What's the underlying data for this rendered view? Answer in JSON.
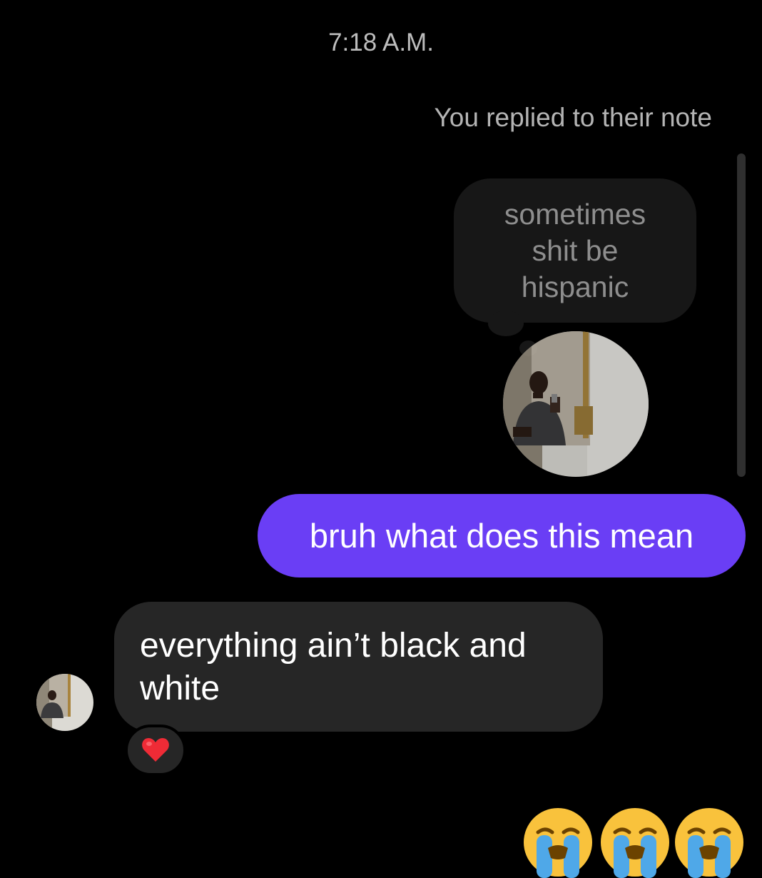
{
  "header": {
    "timestamp": "7:18 A.M."
  },
  "note_reply": {
    "context_label": "You replied to their note",
    "note_text": "sometimes shit be hispanic"
  },
  "messages": {
    "sent": {
      "text": "bruh what does this mean"
    },
    "received": {
      "text": "everything ain’t black and white",
      "reaction": "heart-icon"
    }
  },
  "emoji_message": {
    "emojis": [
      "loudly-crying-face-icon",
      "loudly-crying-face-icon",
      "loudly-crying-face-icon"
    ]
  },
  "colors": {
    "background": "#000000",
    "sent_bubble": "#6a3ef5",
    "received_bubble": "#262626",
    "note_bubble": "#171717"
  }
}
